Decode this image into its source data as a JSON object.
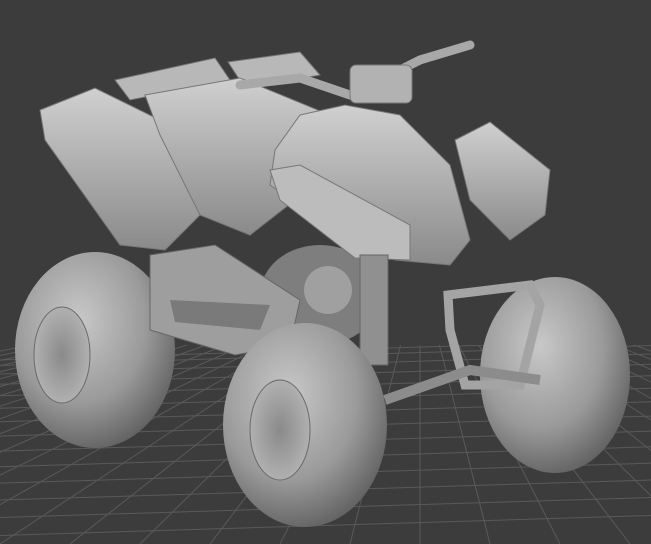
{
  "viewport": {
    "background_color": "#3c3c3c",
    "grid_color": "#5a5a5a",
    "model_color": "#a8a8a8",
    "model_shadow_color": "#6e6e6e",
    "model_highlight_color": "#d4d4d4"
  }
}
